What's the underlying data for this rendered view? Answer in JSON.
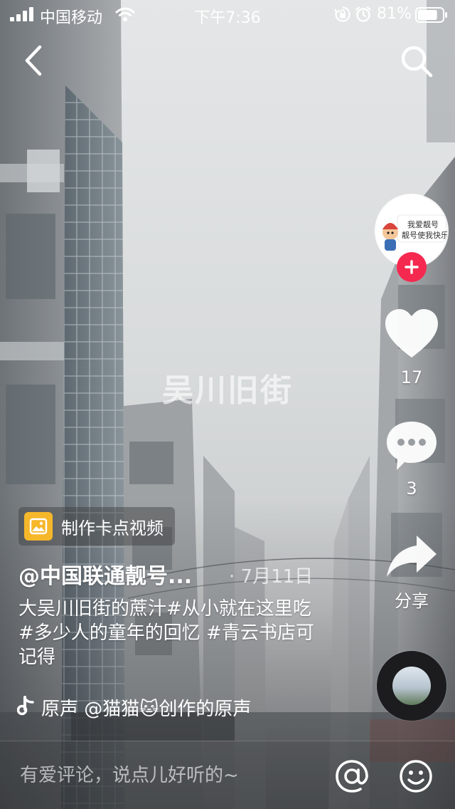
{
  "status_bar": {
    "carrier": "中国移动",
    "time": "下午7:36",
    "battery_percent": "81%",
    "battery_level": 0.81
  },
  "nav": {
    "back_icon": "chevron-left-icon",
    "search_icon": "search-icon"
  },
  "video": {
    "overlay_title": "吴川旧街"
  },
  "side": {
    "avatar_line1": "我爱靓号",
    "avatar_line2": "靓号使我快乐",
    "like_count": "17",
    "comment_count": "3",
    "share_label": "分享"
  },
  "info": {
    "template_label": "制作卡点视频",
    "author": "@中国联通靓号...",
    "date": "· 7月11日",
    "caption": "大吴川旧街的蔗汁#从小就在这里吃#多少人的童年的回忆 #青云书店可记得",
    "music": "原声    @猫猫🐱创作的原声"
  },
  "comment_bar": {
    "placeholder": "有爱评论，说点儿好听的~"
  },
  "colors": {
    "accent_red": "#f5294f",
    "template_yellow": "#f6b72a"
  }
}
